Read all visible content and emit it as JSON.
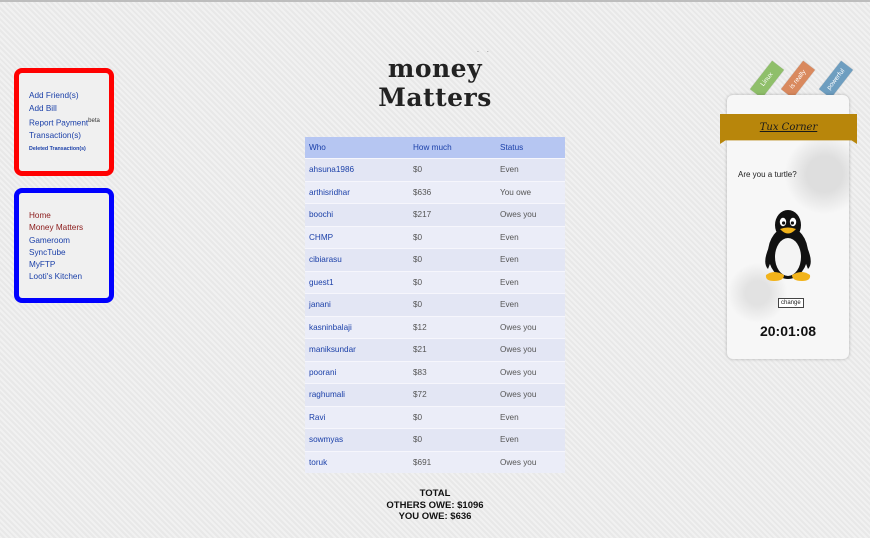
{
  "actions_menu": {
    "items": [
      {
        "label": "Add Friend(s)"
      },
      {
        "label": "Add Bill"
      },
      {
        "label": "Report Payment",
        "sup": "beta"
      },
      {
        "label": "Transaction(s)"
      },
      {
        "label": "Deleted Transaction(s)"
      }
    ]
  },
  "site_nav": {
    "items": [
      {
        "label": "Home"
      },
      {
        "label": "Money Matters"
      },
      {
        "label": "Gameroom"
      },
      {
        "label": "SyncTube"
      },
      {
        "label": "MyFTP"
      },
      {
        "label": "Looti's Kitchen"
      }
    ]
  },
  "logo": {
    "text": "money Matters",
    "dots": ". ."
  },
  "table": {
    "headers": {
      "who": "Who",
      "amount": "How much",
      "status": "Status"
    },
    "rows": [
      {
        "who": "ahsuna1986",
        "amount": "$0",
        "status": "Even"
      },
      {
        "who": "arthisridhar",
        "amount": "$636",
        "status": "You owe"
      },
      {
        "who": "boochi",
        "amount": "$217",
        "status": "Owes you"
      },
      {
        "who": "CHMP",
        "amount": "$0",
        "status": "Even"
      },
      {
        "who": "cibiarasu",
        "amount": "$0",
        "status": "Even"
      },
      {
        "who": "guest1",
        "amount": "$0",
        "status": "Even"
      },
      {
        "who": "janani",
        "amount": "$0",
        "status": "Even"
      },
      {
        "who": "kasninbalaji",
        "amount": "$12",
        "status": "Owes you"
      },
      {
        "who": "maniksundar",
        "amount": "$21",
        "status": "Owes you"
      },
      {
        "who": "poorani",
        "amount": "$83",
        "status": "Owes you"
      },
      {
        "who": "raghumali",
        "amount": "$72",
        "status": "Owes you"
      },
      {
        "who": "Ravi",
        "amount": "$0",
        "status": "Even"
      },
      {
        "who": "sowmyas",
        "amount": "$0",
        "status": "Even"
      },
      {
        "who": "toruk",
        "amount": "$691",
        "status": "Owes you"
      }
    ]
  },
  "totals": {
    "heading": "TOTAL",
    "others_owe": "OTHERS OWE: $1096",
    "you_owe": "YOU OWE: $636"
  },
  "tux_corner": {
    "title": "Tux Corner",
    "question": "Are you a turtle?",
    "change_label": "change",
    "clock": "20:01:08",
    "tags": [
      "Linux",
      "is really",
      "powerful"
    ],
    "icon": "tux-penguin-icon",
    "ribbon_color": "#b8860b"
  },
  "colors": {
    "red_box": "#ff0000",
    "blue_box": "#0000ff",
    "table_header": "#b6c6f2",
    "link": "#1a3fa8"
  }
}
